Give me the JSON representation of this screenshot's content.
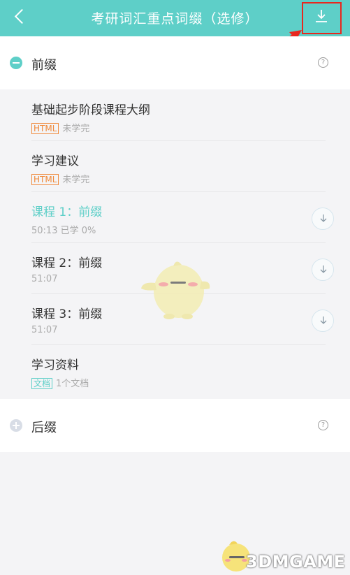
{
  "header": {
    "title": "考研词汇重点词缀（选修）",
    "back_icon": "chevron-left-icon",
    "download_icon": "download-icon",
    "accent_color": "#5ecfc8"
  },
  "sections": [
    {
      "title": "前缀",
      "state": "expanded",
      "help": "?",
      "items": [
        {
          "title": "基础起步阶段课程大纲",
          "tag": "HTML",
          "status": "未学完"
        },
        {
          "title": "学习建议",
          "tag": "HTML",
          "status": "未学完"
        },
        {
          "title": "课程 1：前缀",
          "meta": "50:13  已学 0%",
          "active": true
        },
        {
          "title": "课程 2：前缀",
          "meta": "51:07"
        },
        {
          "title": "课程 3：前缀",
          "meta": "51:07"
        },
        {
          "title": "学习资料",
          "tag": "文档",
          "status": "1个文档"
        }
      ]
    },
    {
      "title": "后缀",
      "state": "collapsed",
      "help": "?"
    }
  ],
  "watermark": {
    "text": "3DMGAME"
  }
}
